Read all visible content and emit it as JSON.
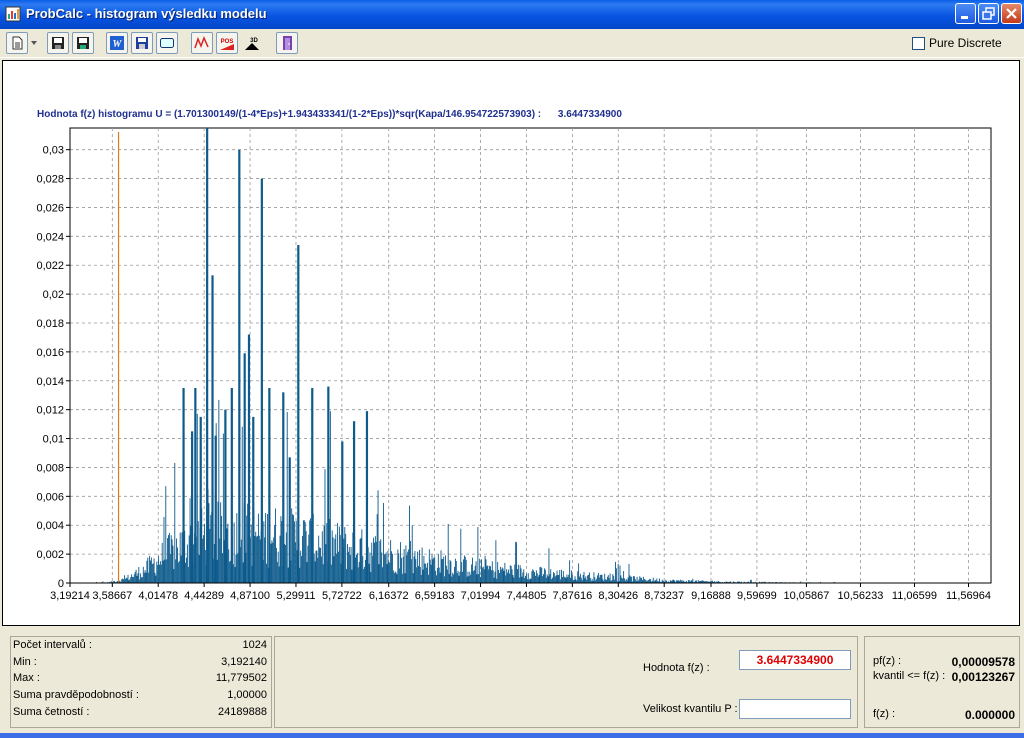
{
  "window": {
    "title": "ProbCalc  - histogram  výsledku modelu"
  },
  "toolbar": {
    "buttons": [
      "new-document-icon",
      "save-icon",
      "save-as-icon",
      "word-export-icon",
      "disk-icon",
      "frame-icon",
      "line-chart-icon",
      "pos-chart-icon",
      "3d-chart-icon",
      "exit-door-icon"
    ],
    "pure_discrete_label": "Pure Discrete",
    "pure_discrete_checked": false
  },
  "chart": {
    "title": "Hodnota f(z) histogramu U = (1.701300149/(1-4*Eps)+1.943433341/(1-2*Eps))*sqr(Kapa/146.954722573903) :",
    "title_value": "3.6447334900",
    "bar_color": "#0d5a8c",
    "marker_color": "#e07b1a"
  },
  "chart_data": {
    "type": "bar",
    "xlabel": "",
    "ylabel": "",
    "ylim": [
      0,
      0.0315
    ],
    "xlim": [
      3.19214,
      11.779502
    ],
    "grid": true,
    "yticks": [
      "0",
      "0,002",
      "0,004",
      "0,006",
      "0,008",
      "0,01",
      "0,012",
      "0,014",
      "0,016",
      "0,018",
      "0,02",
      "0,022",
      "0,024",
      "0,026",
      "0,028",
      "0,03"
    ],
    "ytick_values": [
      0,
      0.002,
      0.004,
      0.006,
      0.008,
      0.01,
      0.012,
      0.014,
      0.016,
      0.018,
      0.02,
      0.022,
      0.024,
      0.026,
      0.028,
      0.03
    ],
    "xticks": [
      "3,19214",
      "3,58667",
      "4,01478",
      "4,44289",
      "4,87100",
      "5,29911",
      "5,72722",
      "6,16372",
      "6,59183",
      "7,01994",
      "7,44805",
      "7,87616",
      "8,30426",
      "8,73237",
      "9,16888",
      "9,59699",
      "10,05867",
      "10,56233",
      "11,06599",
      "11,56964"
    ],
    "xtick_values": [
      3.19214,
      3.58667,
      4.01478,
      4.44289,
      4.871,
      5.29911,
      5.72722,
      6.16372,
      6.59183,
      7.01994,
      7.44805,
      7.87616,
      8.30426,
      8.73237,
      9.16888,
      9.59699,
      10.05867,
      10.56233,
      11.06599,
      11.56964
    ],
    "marker_x": 3.64473349,
    "peaks": [
      [
        4.25,
        0.0135
      ],
      [
        4.33,
        0.0105
      ],
      [
        4.36,
        0.0135
      ],
      [
        4.41,
        0.0115
      ],
      [
        4.47,
        0.0315
      ],
      [
        4.52,
        0.0213
      ],
      [
        4.55,
        0.0102
      ],
      [
        4.64,
        0.012
      ],
      [
        4.7,
        0.0135
      ],
      [
        4.77,
        0.03
      ],
      [
        4.82,
        0.0159
      ],
      [
        4.86,
        0.0172
      ],
      [
        4.9,
        0.0115
      ],
      [
        4.98,
        0.028
      ],
      [
        5.05,
        0.0135
      ],
      [
        5.18,
        0.0132
      ],
      [
        5.24,
        0.0087
      ],
      [
        5.32,
        0.0234
      ],
      [
        5.45,
        0.0135
      ],
      [
        5.6,
        0.0136
      ],
      [
        5.73,
        0.0098
      ],
      [
        5.84,
        0.0112
      ],
      [
        5.96,
        0.0119
      ]
    ],
    "envelope": [
      [
        3.19214,
        0.0
      ],
      [
        3.55,
        5e-05
      ],
      [
        3.7,
        0.0003
      ],
      [
        3.9,
        0.0012
      ],
      [
        4.1,
        0.0025
      ],
      [
        4.3,
        0.0035
      ],
      [
        4.5,
        0.0042
      ],
      [
        4.7,
        0.0042
      ],
      [
        4.9,
        0.0042
      ],
      [
        5.2,
        0.004
      ],
      [
        5.5,
        0.0035
      ],
      [
        5.8,
        0.003
      ],
      [
        6.2,
        0.0024
      ],
      [
        6.6,
        0.0018
      ],
      [
        7.0,
        0.0013
      ],
      [
        7.5,
        0.0009
      ],
      [
        8.0,
        0.0006
      ],
      [
        8.4,
        0.0004
      ],
      [
        8.8,
        0.0002
      ],
      [
        9.3,
        0.0001
      ],
      [
        9.8,
        5e-05
      ],
      [
        10.5,
        1e-05
      ],
      [
        11.779502,
        0.0
      ]
    ]
  },
  "stats": {
    "rows": [
      {
        "label": "Počet intervalů :",
        "value": "1024"
      },
      {
        "label": "Min :",
        "value": "3,192140"
      },
      {
        "label": "Max :",
        "value": "11,779502"
      },
      {
        "label": "Suma pravděpodobností :",
        "value": "1,00000"
      },
      {
        "label": "Suma četností :",
        "value": "24189888"
      }
    ]
  },
  "inputs": {
    "f_label": "Hodnota f(z) :",
    "f_value": "3.6447334900",
    "quantile_label": "Velikost kvantilu P :",
    "quantile_value": ""
  },
  "results": {
    "pf_label": "pf(z) :",
    "pf_value": "0,00009578",
    "kvantil_label": "kvantil <= f(z) :",
    "kvantil_value": "0,00123267",
    "f_label": "f(z) :",
    "f_value": "0.000000"
  }
}
